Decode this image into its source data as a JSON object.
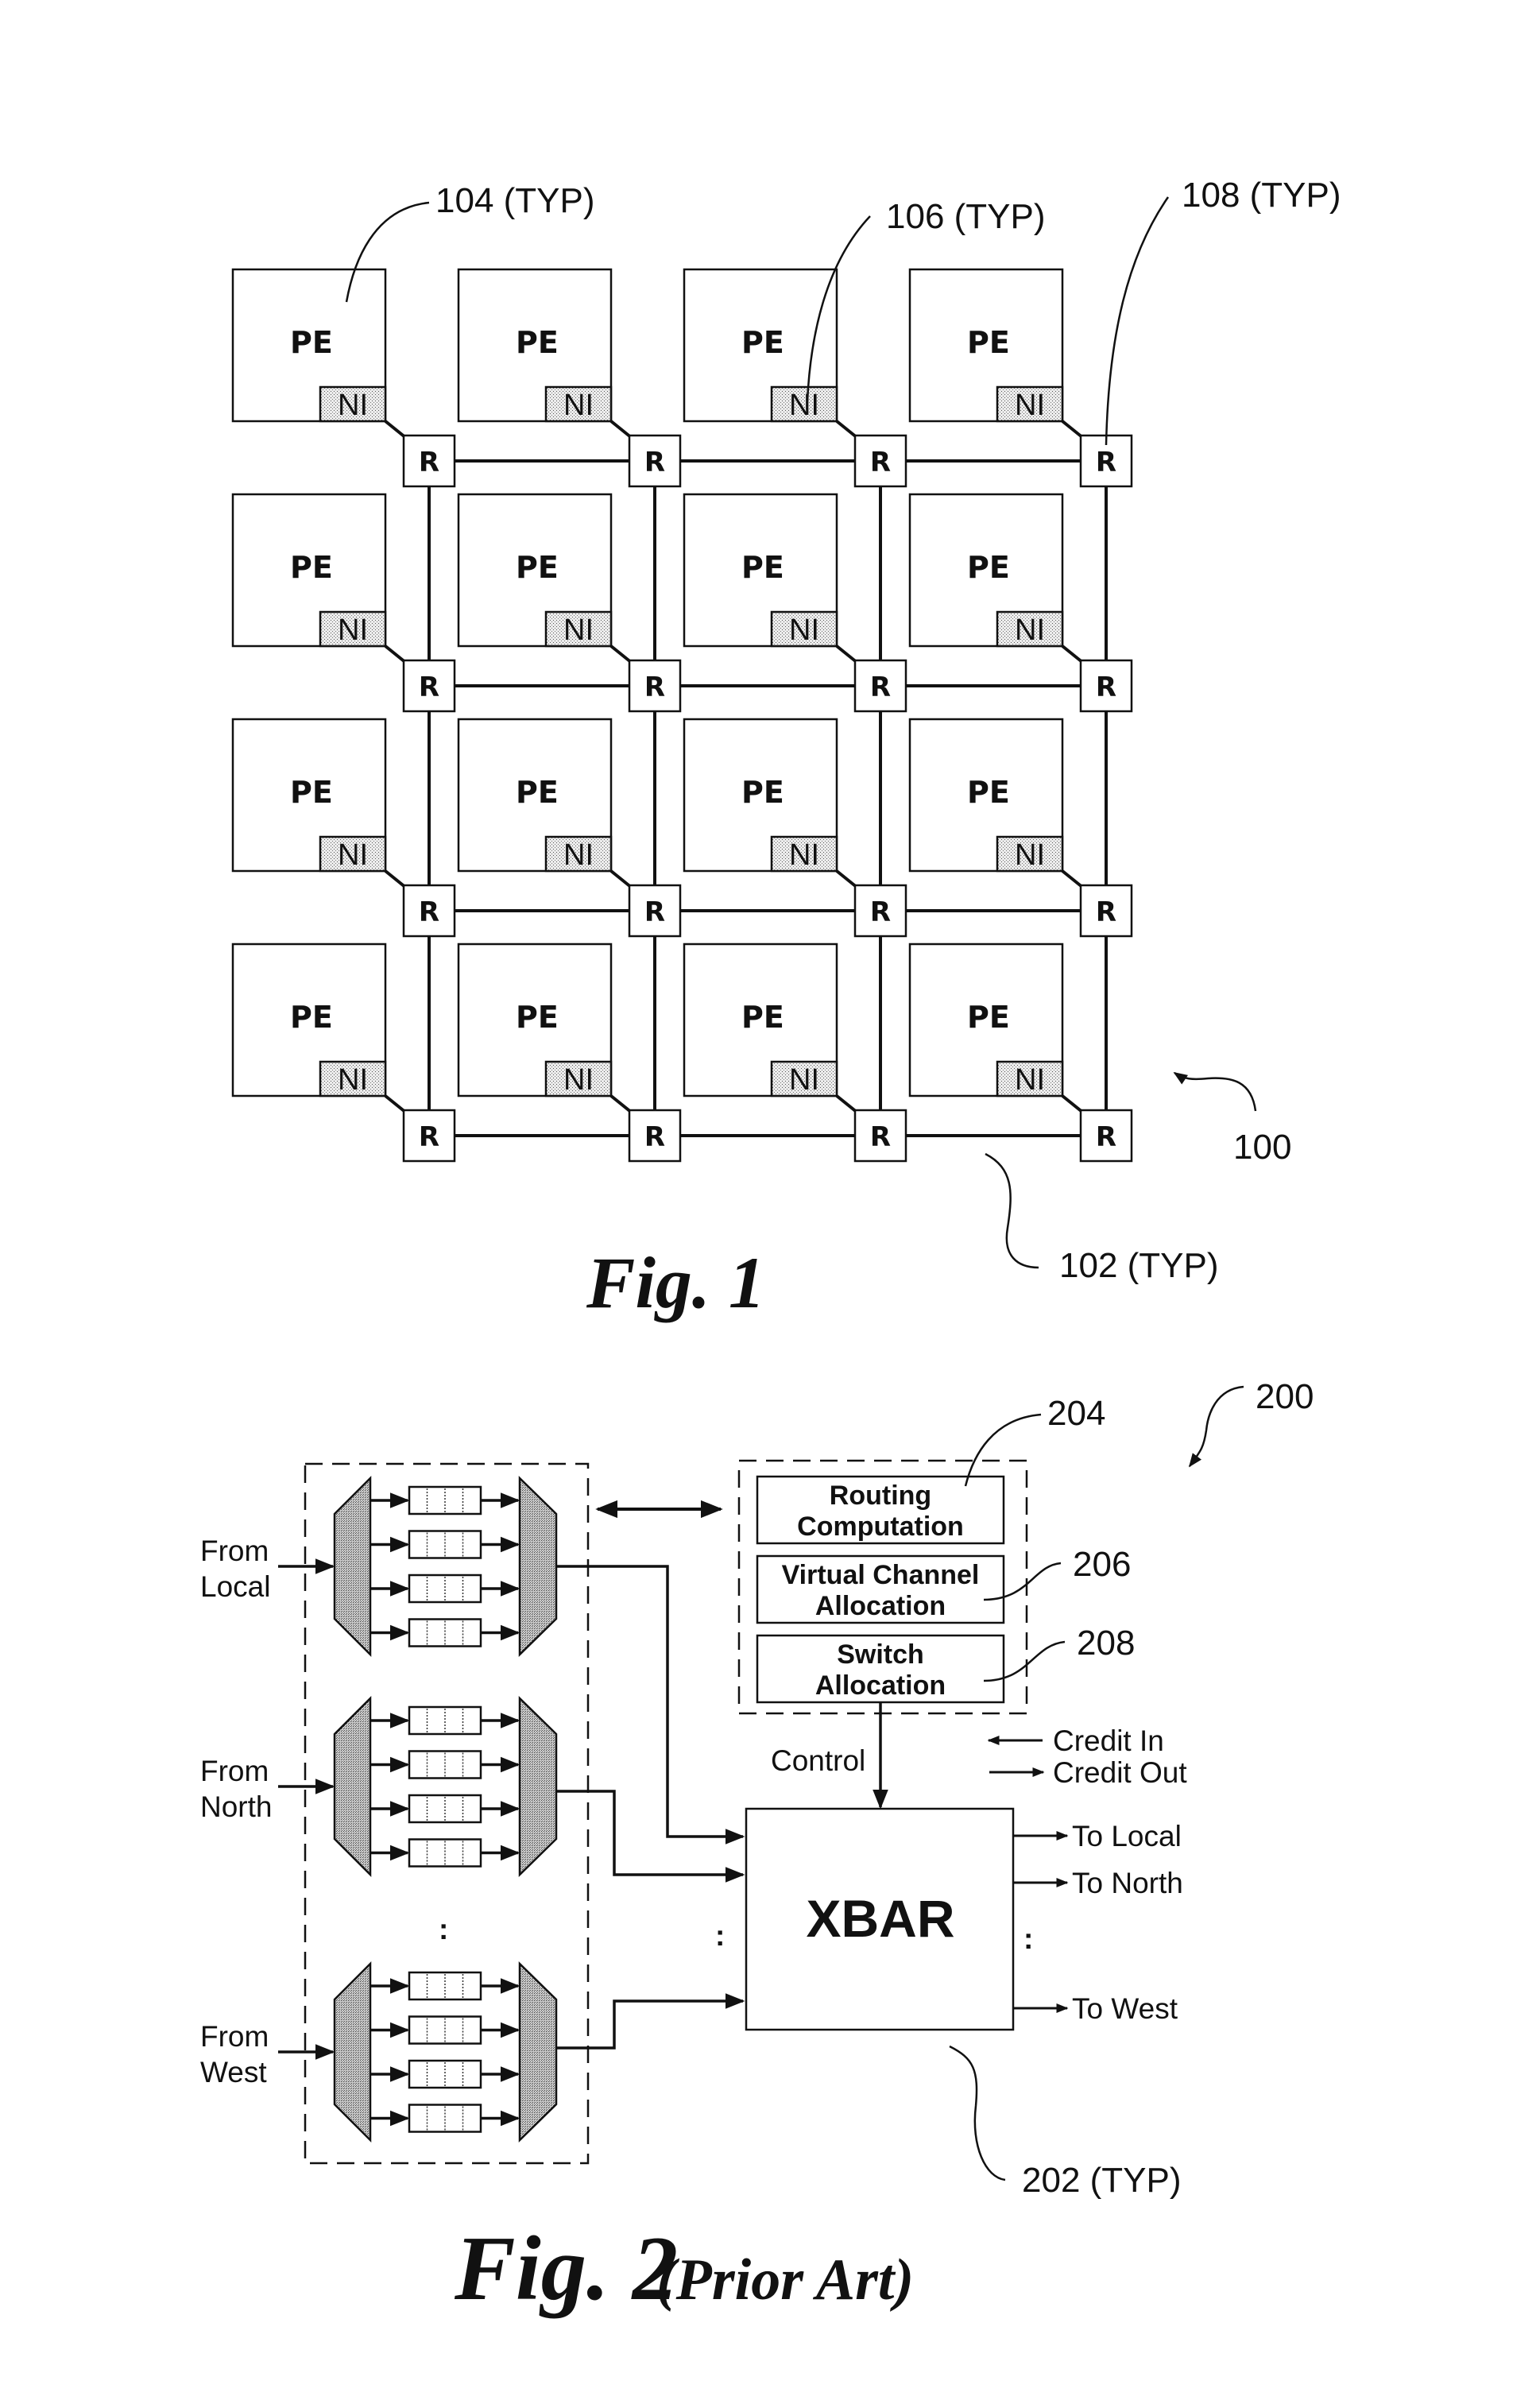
{
  "page": {
    "background": "#ffffff",
    "ink": "#111111",
    "ni_fill": "#d9d9d9",
    "mux_fill": "#b5b5b5"
  },
  "fig1": {
    "caption": "Fig. 1",
    "grid": {
      "rows": 4,
      "cols": 4
    },
    "pe_label": "PE",
    "ni_label": "NI",
    "router_label": "R",
    "refs": {
      "pe": "104 (TYP)",
      "ni": "106 (TYP)",
      "router": "108 (TYP)",
      "link": "102 (TYP)",
      "network": "100"
    }
  },
  "fig2": {
    "caption": "Fig. 2",
    "caption_suffix": "(Prior Art)",
    "inputs": [
      {
        "line1": "From",
        "line2": "Local"
      },
      {
        "line1": "From",
        "line2": "North"
      },
      {
        "line1": "From",
        "line2": "West"
      }
    ],
    "virtual_channels_per_input": 4,
    "buffer_slots": 4,
    "ellipsis": ":",
    "control": {
      "routing": {
        "line1": "Routing",
        "line2": "Computation"
      },
      "vc_alloc": {
        "line1": "Virtual Channel",
        "line2": "Allocation"
      },
      "switch_alloc": {
        "line1": "Switch",
        "line2": "Allocation"
      }
    },
    "control_label": "Control",
    "credit_in": "Credit In",
    "credit_out": "Credit Out",
    "xbar_label": "XBAR",
    "outputs": [
      "To Local",
      "To North",
      "To West"
    ],
    "refs": {
      "system": "200",
      "routing": "204",
      "vc_alloc": "206",
      "switch_alloc": "208",
      "xbar": "202 (TYP)"
    }
  }
}
